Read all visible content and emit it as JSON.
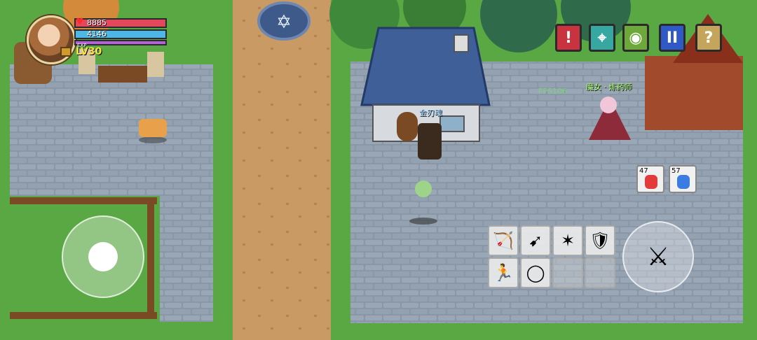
{
  "player": {
    "hp": "8885",
    "mp": "4146",
    "xp_label": "EXP",
    "level": "LV30",
    "name": "金刃魂"
  },
  "top_buttons": [
    {
      "name": "alert-button",
      "glyph": "!",
      "color": "#c9333f"
    },
    {
      "name": "map-pin-button",
      "glyph": "⌖",
      "color": "#37a7a2"
    },
    {
      "name": "egg-button",
      "glyph": "◉",
      "color": "#6fa83a"
    },
    {
      "name": "pause-button",
      "glyph": "II",
      "color": "#2f59c7"
    },
    {
      "name": "help-button",
      "glyph": "?",
      "color": "#c5a45c"
    }
  ],
  "fps": "FPS106",
  "npc": {
    "name": "魔女 · 炼药师"
  },
  "potions": [
    {
      "count": "47",
      "color": "#e33b3b"
    },
    {
      "count": "57",
      "color": "#3b7ce3"
    }
  ],
  "skills": [
    {
      "name": "crossbow-skill",
      "icon": "🏹"
    },
    {
      "name": "bow-skill",
      "icon": "➹"
    },
    {
      "name": "multishot-skill",
      "icon": "✶"
    },
    {
      "name": "shield-skill",
      "icon": "🛡"
    },
    {
      "name": "dash-skill",
      "icon": "🏃"
    },
    {
      "name": "ring-skill",
      "icon": "◯"
    },
    {
      "name": "empty-slot-1",
      "icon": ""
    },
    {
      "name": "empty-slot-2",
      "icon": ""
    }
  ],
  "colors": {
    "grass": "#5aa844",
    "cobble": "#8b98a6",
    "dirt": "#c99a63",
    "roof": "#3f5f98"
  }
}
